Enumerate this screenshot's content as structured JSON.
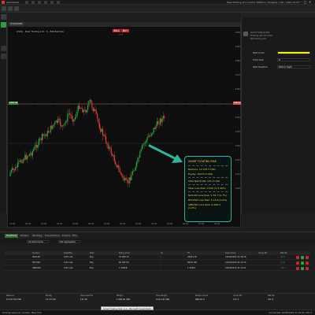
{
  "app": {
    "name": "Quantower"
  },
  "window": {
    "status": "Real Trading Ltd / Demo 308514 / Hedging 1:50 / 2024.10.03"
  },
  "chart": {
    "tab_label": "US30/USD",
    "info": "US30 · Real Trading Ltd · 5 · Bid/Ask/Ask",
    "sell_label": "SELL",
    "buy_label": "BUY",
    "spread": "2.0",
    "price_ticks": [
      "4200",
      "4190",
      "4180",
      "4170",
      "4160",
      "4150",
      "4140",
      "4130",
      "4120",
      "4110",
      "4100"
    ],
    "time_ticks": [
      "19:00",
      "20:00",
      "21:00",
      "22:00",
      "23:00",
      "00:00",
      "01:00",
      "02:00",
      "03:00",
      "04:00",
      "05:00",
      "06:00",
      "07:00",
      "08:00",
      "09:00"
    ],
    "left_badge": "4163.40",
    "right_badge": "4163.4",
    "colors": {
      "up": "#2ea043",
      "down": "#e03c3c",
      "price_line": "#d9534f",
      "ref_line": "#2f6b2f"
    }
  },
  "smart_floating": {
    "title": "SMART FLOATING RISK",
    "balance": "Balance: 10 107.5 USD",
    "equity": "Equity: 10273.3 USD",
    "total_net": "Total Net Profit: 121.3 USD",
    "total_loss": "Total Loss Risk: 0.000 ($ 0.00%)",
    "lines": [
      "NAS100 Loss Risk: $ 34.7 (0.7%)",
      "BTCUSD Loss Risk: $ 14.9 (0.6%)",
      "GBPUSD Loss Risk: $ 498.9 (1.0%)"
    ]
  },
  "right_panel": {
    "company": "Smart Floating Risk",
    "line1": "Floating risk calculator",
    "line2": "Real Trading Ltd",
    "rows": [
      {
        "label": "Text Color",
        "value": ""
      },
      {
        "label": "Font Size",
        "value": "8"
      },
      {
        "label": "Text Position",
        "value": "Bottom Right"
      }
    ],
    "highlight_color": "#f2f200"
  },
  "bottom": {
    "tabs": [
      "Positions",
      "Orders",
      "Working",
      "Transactions",
      "Events",
      "Fills"
    ],
    "filter1": "All instruments",
    "filter2": "Not aggregated",
    "columns": [
      "Symbol",
      "Quantity",
      "Side",
      "Entry price",
      "SL",
      "TP",
      "Open time",
      "Gross P/L",
      "Net P/L"
    ],
    "rows": [
      {
        "symbol": "NAS100",
        "quantity": "0.01 Lots",
        "side": "Buy",
        "entry": "19 955.10",
        "sl": "-",
        "tp": "20041.70",
        "time": "10/03/2024 21:16:16",
        "net": "34.0"
      },
      {
        "symbol": "BTCUSD",
        "quantity": "0.01 Lots",
        "side": "Buy",
        "entry": "60 987.00",
        "sl": "-",
        "tp": "60915.80",
        "time": "10/03/2024 21:14:15",
        "net": "14.6"
      },
      {
        "symbol": "GBPUSD",
        "quantity": "0.01 Lots",
        "side": "Buy",
        "entry": "1.30656",
        "sl": "-",
        "tp": "1.30957",
        "time": "10/03/2024 21:19:41",
        "net": "-30.9"
      }
    ],
    "summary_labels": [
      "Balance",
      "Equity",
      "Open Net P/L",
      "Margin",
      "Free Margin",
      "Margin Level",
      "Gross P/L",
      "Net P/L"
    ],
    "summary_values": [
      "10 107.50 USD",
      "10 273.30",
      "121.30",
      "1 060.90 USD",
      "9 212.40 USD",
      "968.40 %",
      "121.3",
      "121.3"
    ]
  },
  "status": {
    "left": "Trading sessions: London, New York",
    "right": "Connected   10/03/2024 21:21:41   UTC-4",
    "tooltip": "Smart Floating Risk v1.0 · Microsoft Visual Studio"
  }
}
